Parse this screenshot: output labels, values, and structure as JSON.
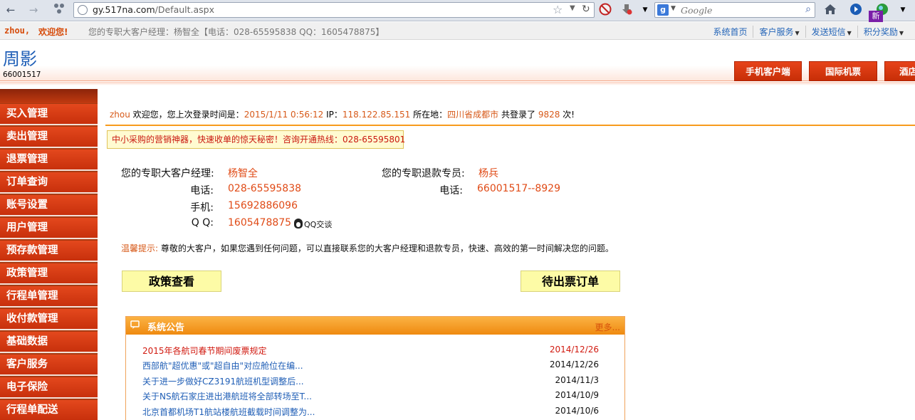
{
  "browser": {
    "url_host": "gy.517na.com",
    "url_path": "/Default.aspx",
    "search_placeholder": "Google",
    "search_engine_letter": "g"
  },
  "info_bar": {
    "user": "zhou,",
    "welcome": "欢迎您!",
    "manager_info": "您的专职大客户经理：杨智全【电话：028-65595838 QQ：1605478875】",
    "links": [
      "系统首页",
      "客户服务",
      "发送短信",
      "积分奖励"
    ]
  },
  "header": {
    "brand_name": "周影",
    "brand_code": "66001517",
    "tabs": [
      "手机客户端",
      "国际机票",
      "酒店"
    ],
    "new_badge": "新"
  },
  "sidebar": {
    "items": [
      "买入管理",
      "卖出管理",
      "退票管理",
      "订单查询",
      "账号设置",
      "用户管理",
      "预存款管理",
      "政策管理",
      "行程单管理",
      "收付款管理",
      "基础数据",
      "客户服务",
      "电子保险",
      "行程单配送"
    ]
  },
  "welcome": {
    "user": "zhou",
    "text1": " 欢迎您，您上次登录时间是：",
    "last_login": "2015/1/11 0:56:12",
    "ip_label": " IP：",
    "ip": "118.122.85.151",
    "loc_label": " 所在地：",
    "location": "四川省成都市",
    "count_label": " 共登录了 ",
    "count": "9828",
    "count_suffix": " 次!"
  },
  "promo": "中小采购的营销神器，快速收单的惊天秘密！咨询开通热线：028-65595801",
  "contact": {
    "manager_label": "您的专职大客户经理:",
    "manager_name": "杨智全",
    "phone_label": "电话:",
    "phone": "028-65595838",
    "mobile_label": "手机:",
    "mobile": "15692886096",
    "qq_label": "Q Q:",
    "qq": "1605478875",
    "qq_chat": "QQ交谈",
    "refund_label": "您的专职退款专员:",
    "refund_name": "杨兵",
    "refund_phone_label": "电话:",
    "refund_phone": "66001517--8929"
  },
  "tip": {
    "label": "温馨提示:",
    "text": " 尊敬的大客户，如果您遇到任何问题，可以直接联系您的大客户经理和退款专员，快速、高效的第一时间解决您的问题。"
  },
  "buttons": {
    "policy": "政策查看",
    "pending": "待出票订单"
  },
  "notices": {
    "title": "系统公告",
    "more": "更多...",
    "items": [
      {
        "text": "2015年各航司春节期间废票规定",
        "date": "2014/12/26"
      },
      {
        "text": "西部航\"超优惠\"或\"超自由\"对应舱位在编...",
        "date": "2014/12/26"
      },
      {
        "text": "关于进一步做好CZ3191航班机型调整后...",
        "date": "2014/11/3"
      },
      {
        "text": "关于NS航石家庄进出港航班将全部转场至T...",
        "date": "2014/10/9"
      },
      {
        "text": "北京首都机场T1航站楼航班截载时间调整为...",
        "date": "2014/10/6"
      }
    ]
  }
}
